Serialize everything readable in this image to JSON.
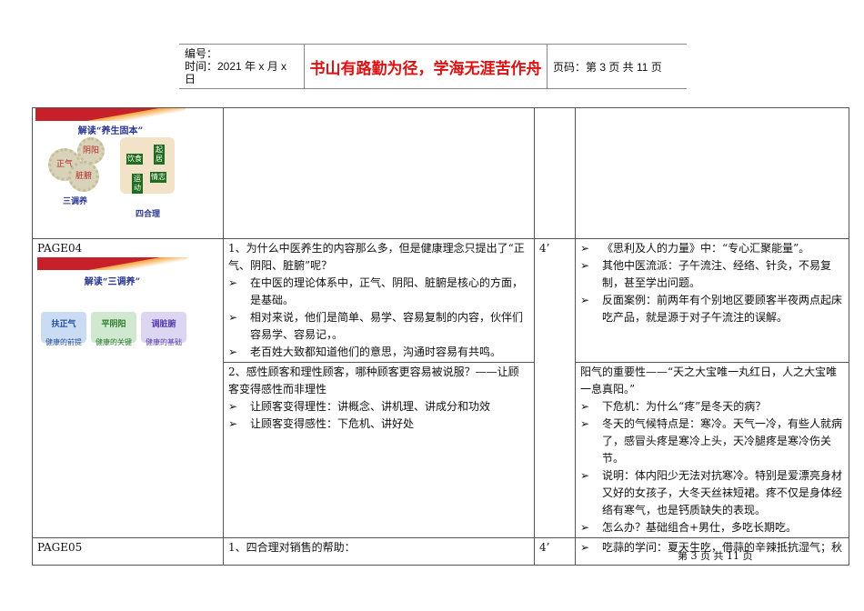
{
  "header": {
    "number_label": "编号：",
    "date_label": "时间：2021 年 x 月 x 日",
    "motto": "书山有路勤为径，学海无涯苦作舟",
    "page_label": "页码：第 3 页  共 11 页"
  },
  "slides": {
    "s1": {
      "title": "解读“养生固本”",
      "gears": [
        "正气",
        "阴阳",
        "脏腑"
      ],
      "gear_caption": "三调养",
      "puzzle": [
        "饮食",
        "起居",
        "运动",
        "情志"
      ],
      "puzzle_caption": "四合理"
    },
    "s2": {
      "title": "解读“三调养”",
      "cards": [
        {
          "t": "扶正气",
          "s": "健康的前提",
          "color": "#c9dcf3"
        },
        {
          "t": "平阴阳",
          "s": "健康的关键",
          "color": "#cfe8cf"
        },
        {
          "t": "调脏腑",
          "s": "健康的基础",
          "color": "#dcd6f2"
        }
      ]
    }
  },
  "rows": [
    {
      "page": "PAGE04",
      "time": "4’",
      "c2a": {
        "q": "1、为什么中医养生的内容那么多，但是健康理念只提出了“正气、阴阳、脏腑”呢？",
        "items": [
          "在中医的理论体系中，正气、阴阳、脏腑是核心的方面，是基础。",
          "相对来说，他们是简单、易学、容易复制的内容，伙伴们容易学、容易记，。",
          "老百姓大致都知道他们的意思，沟通时容易有共鸣。"
        ]
      },
      "c4a": {
        "items": [
          "《思利及人的力量》中：“专心汇聚能量”。",
          "其他中医流派：子午流注、经络、针灸，不易复制，甚至学出问题。",
          "反面案例：前两年有个别地区要顾客半夜两点起床吃产品，就是源于对子午流注的误解。"
        ]
      },
      "c2b": {
        "q": "2、感性顾客和理性顾客，哪种顾客更容易被说服？——让顾客变得感性而非理性",
        "items": [
          "让顾客变得理性：讲概念、讲机理、讲成分和功效",
          "让顾客变得感性：下危机、讲好处"
        ]
      },
      "c4b": {
        "q": "阳气的重要性——“天之大宝唯一丸红日，人之大宝唯一息真阳。”",
        "items": [
          "下危机：为什么“疼”是冬天的病？",
          "冬天的气候特点是：寒冷。天气一冷，有些人就病了，感冒头疼是寒冷上头，天冷腿疼是寒冷伤关节。",
          "说明：体内阳少无法对抗寒冷。特别是爱漂亮身材又好的女孩子，大冬天丝袜短裙。疼不仅是身体经络有寒气，也是钙质缺失的表现。",
          "怎么办？基础组合+男仕，多吃长期吃。"
        ]
      }
    },
    {
      "page": "PAGE05",
      "time": "4’",
      "c2": "1、四合理对销售的帮助：",
      "c4": "吃蒜的学问：夏天生吃，借蒜的辛辣抵抗湿气；秋"
    }
  ],
  "bullet": "➢",
  "footer": "第 3 页 共 11 页"
}
